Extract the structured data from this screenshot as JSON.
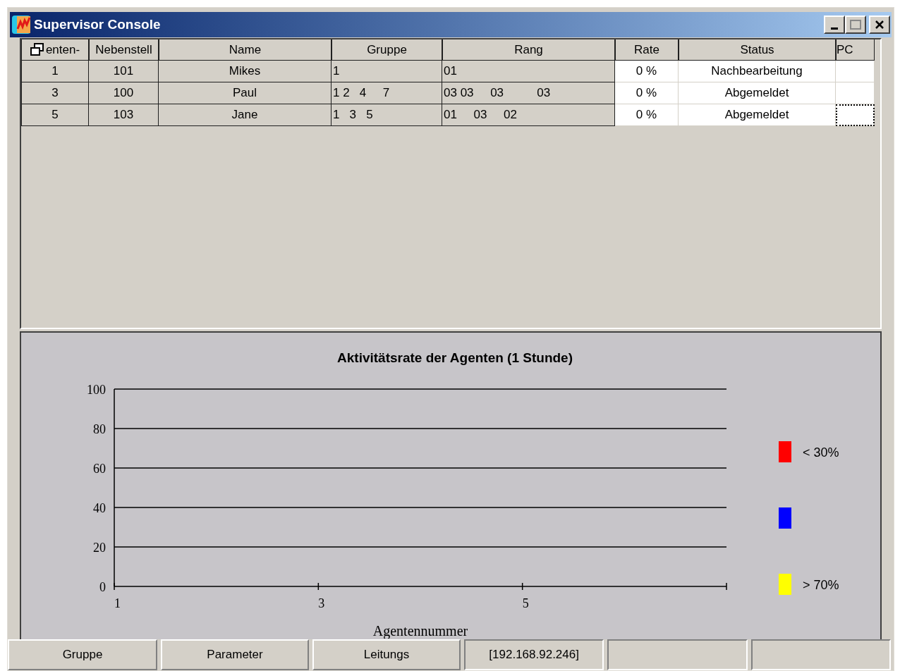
{
  "window": {
    "title": "Supervisor Console"
  },
  "table": {
    "columns": [
      "enten-",
      "Nebenstell",
      "Name",
      "Gruppe",
      "Rang",
      "Rate",
      "Status",
      "PC"
    ],
    "rows": [
      {
        "cells": [
          "1",
          "101",
          "Mikes",
          "1",
          "01",
          "0 %",
          "Nachbearbeitung",
          ""
        ],
        "pc_focused": false
      },
      {
        "cells": [
          "3",
          "100",
          "Paul",
          "1 2   4     7",
          "03 03     03          03",
          "0 %",
          "Abgemeldet",
          ""
        ],
        "pc_focused": false
      },
      {
        "cells": [
          "5",
          "103",
          "Jane",
          "1   3   5",
          "01     03     02",
          "0 %",
          "Abgemeldet",
          ""
        ],
        "pc_focused": true
      }
    ]
  },
  "chart": {
    "chart_data": {
      "type": "bar",
      "grid": true,
      "title": "Aktivitätsrate der Agenten  (1 Stunde)",
      "xlabel": "Agentennummer",
      "xlim": [
        1,
        7
      ],
      "xticks": [
        1,
        3,
        5
      ],
      "ylim": [
        0,
        100
      ],
      "yticks": [
        0,
        20,
        40,
        60,
        80,
        100
      ]
    },
    "legend": [
      {
        "color": "#ff0000",
        "label": "< 30%"
      },
      {
        "color": "#0000ff"
      },
      {
        "color": "#ffff00",
        "label": "> 70%"
      }
    ]
  },
  "status_bar": [
    {
      "kind": "button",
      "text": "Gruppe"
    },
    {
      "kind": "button",
      "text": "Parameter"
    },
    {
      "kind": "button",
      "text": "Leitungs"
    },
    {
      "kind": "panel",
      "text": "[192.168.92.246]"
    },
    {
      "kind": "panel"
    },
    {
      "kind": "panel"
    }
  ]
}
